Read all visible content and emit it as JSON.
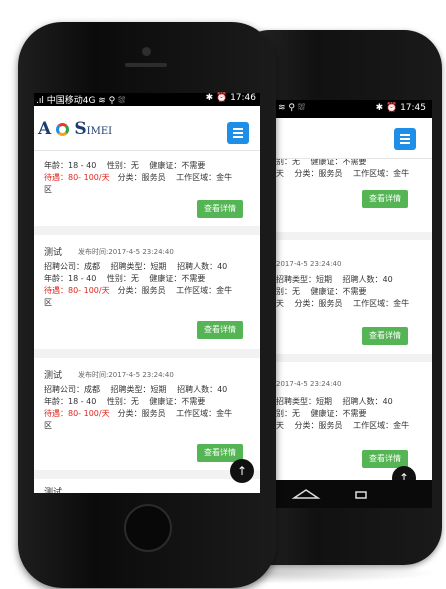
{
  "front": {
    "status": {
      "left": ".ıl 中国移动4G ≋ ⚲ ⛆",
      "right": "✱ ⏰ 17:46"
    },
    "logo": {
      "a": "A",
      "s": "S",
      "rest": "IMEI"
    },
    "cards": [
      {
        "lines": [
          "年龄：18 - 40　 性别：无　 健康证：不需要"
        ],
        "salary": "待遇：80- 100/天",
        "cat": "　分类：服务员　 工作区域：金牛",
        "area": "区",
        "btn": "查看详情"
      },
      {
        "title": "测试",
        "time": "发布时间:2017-4-5 23:24:40",
        "lines": [
          "招聘公司：成都　 招聘类型：短期　 招聘人数：40",
          "年龄：18 - 40　 性别：无　 健康证：不需要"
        ],
        "salary": "待遇：80- 100/天",
        "cat": "　分类：服务员　 工作区域：金牛",
        "area": "区",
        "btn": "查看详情"
      },
      {
        "title": "测试",
        "time": "发布时间:2017-4-5 23:24:40",
        "lines": [
          "招聘公司：成都　 招聘类型：短期　 招聘人数：40",
          "年龄：18 - 40　 性别：无　 健康证：不需要"
        ],
        "salary": "待遇：80- 100/天",
        "cat": "　分类：服务员　 工作区域：金牛",
        "area": "区",
        "btn": "查看详情"
      }
    ],
    "next_title": "测试",
    "scroll_top": "↑"
  },
  "back": {
    "status": {
      "left": "≋ ⚲ ⛆",
      "right": "✱ ⏰ 17:45"
    },
    "cards": [
      {
        "l1": "别：无　 健康证：不需要",
        "l2": "天　 分类：服务员　 工作区域：金牛",
        "btn": "查看详情"
      },
      {
        "time": "2017-4-5 23:24:40",
        "l0": "招聘类型：短期　 招聘人数：40",
        "l1": "别：无　 健康证：不需要",
        "l2": "天　 分类：服务员　 工作区域：金牛",
        "btn": "查看详情"
      },
      {
        "time": "2017-4-5 23:24:40",
        "l0": "招聘类型：短期　 招聘人数：40",
        "l1": "别：无　 健康证：不需要",
        "l2": "天　 分类：服务员　 工作区域：金牛",
        "btn": "查看详情"
      }
    ],
    "scroll_top": "↑"
  },
  "colors": {
    "accent": "#1e8ee6",
    "button": "#55b555",
    "salary": "#e0241b"
  }
}
